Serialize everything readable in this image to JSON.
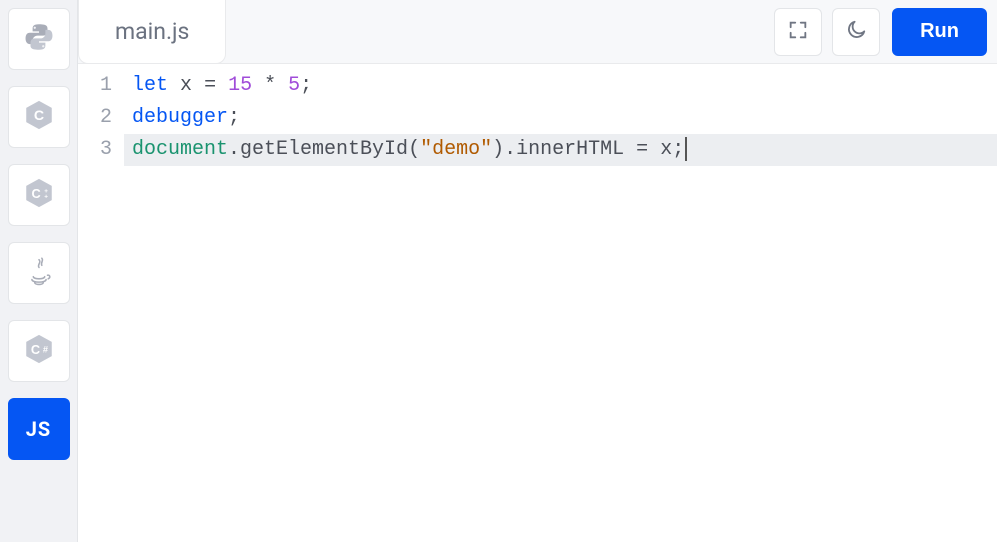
{
  "sidebar": {
    "items": [
      {
        "name": "python",
        "label": "Python",
        "icon": "python-icon"
      },
      {
        "name": "c",
        "label": "C",
        "icon": "c-icon"
      },
      {
        "name": "cpp",
        "label": "C++",
        "icon": "cpp-icon"
      },
      {
        "name": "java",
        "label": "Java",
        "icon": "java-icon"
      },
      {
        "name": "csharp",
        "label": "C#",
        "icon": "csharp-icon"
      },
      {
        "name": "js",
        "label": "JS",
        "icon": "js-icon",
        "active": true
      }
    ]
  },
  "toolbar": {
    "tab_label": "main.js",
    "fullscreen_label": "Fullscreen",
    "theme_label": "Toggle theme",
    "run_label": "Run"
  },
  "editor": {
    "line_numbers": [
      "1",
      "2",
      "3"
    ],
    "active_line_index": 2,
    "lines": [
      {
        "tokens": [
          {
            "cls": "tok-keyword",
            "text": "let"
          },
          {
            "cls": "",
            "text": " "
          },
          {
            "cls": "tok-ident",
            "text": "x"
          },
          {
            "cls": "",
            "text": " "
          },
          {
            "cls": "tok-op",
            "text": "="
          },
          {
            "cls": "",
            "text": " "
          },
          {
            "cls": "tok-number",
            "text": "15"
          },
          {
            "cls": "",
            "text": " "
          },
          {
            "cls": "tok-op",
            "text": "*"
          },
          {
            "cls": "",
            "text": " "
          },
          {
            "cls": "tok-number",
            "text": "5"
          },
          {
            "cls": "tok-punct",
            "text": ";"
          }
        ]
      },
      {
        "tokens": [
          {
            "cls": "tok-keyword",
            "text": "debugger"
          },
          {
            "cls": "tok-punct",
            "text": ";"
          }
        ]
      },
      {
        "tokens": [
          {
            "cls": "tok-builtin",
            "text": "document"
          },
          {
            "cls": "tok-punct",
            "text": "."
          },
          {
            "cls": "tok-ident",
            "text": "getElementById"
          },
          {
            "cls": "tok-punct",
            "text": "("
          },
          {
            "cls": "tok-string",
            "text": "\"demo\""
          },
          {
            "cls": "tok-punct",
            "text": ")"
          },
          {
            "cls": "tok-punct",
            "text": "."
          },
          {
            "cls": "tok-ident",
            "text": "innerHTML"
          },
          {
            "cls": "",
            "text": " "
          },
          {
            "cls": "tok-op",
            "text": "="
          },
          {
            "cls": "",
            "text": " "
          },
          {
            "cls": "tok-ident",
            "text": "x"
          },
          {
            "cls": "tok-punct",
            "text": ";"
          }
        ]
      }
    ]
  },
  "colors": {
    "accent": "#0556f3",
    "sidebar_bg": "#f1f2f5",
    "active_line": "#eceef1"
  }
}
